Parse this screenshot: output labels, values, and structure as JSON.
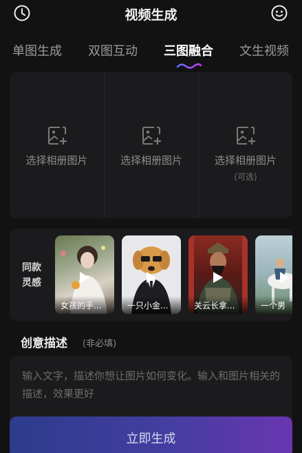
{
  "header": {
    "title": "视频生成",
    "left_icon": "history-clock-icon",
    "right_icon": "smiley-face-icon"
  },
  "tabs": [
    {
      "label": "单图生成",
      "active": false
    },
    {
      "label": "双图互动",
      "active": false
    },
    {
      "label": "三图融合",
      "active": true
    },
    {
      "label": "文生视频",
      "active": false
    }
  ],
  "upload_slots": [
    {
      "label": "选择相册图片",
      "sub": ""
    },
    {
      "label": "选择相册图片",
      "sub": ""
    },
    {
      "label": "选择相册图片",
      "sub": "(可选)"
    }
  ],
  "inspiration": {
    "label": "同款灵感",
    "cards": [
      {
        "caption": "女孩的手..."
      },
      {
        "caption": "一只小金..."
      },
      {
        "caption": "关云长拿..."
      },
      {
        "caption": "一个男"
      }
    ]
  },
  "description": {
    "title": "创意描述",
    "hint": "(非必填)",
    "placeholder": "输入文字，描述你想让图片如何变化。输入和图片相关的描述，效果更好"
  },
  "generate_button": "立即生成",
  "colors": {
    "background": "#121212",
    "panel": "#1b1b1d",
    "button_gradient_start": "#2c3c8c",
    "button_gradient_end": "#6a36b0",
    "tab_underline_start": "#5b6cff",
    "tab_underline_end": "#c43cf0"
  }
}
